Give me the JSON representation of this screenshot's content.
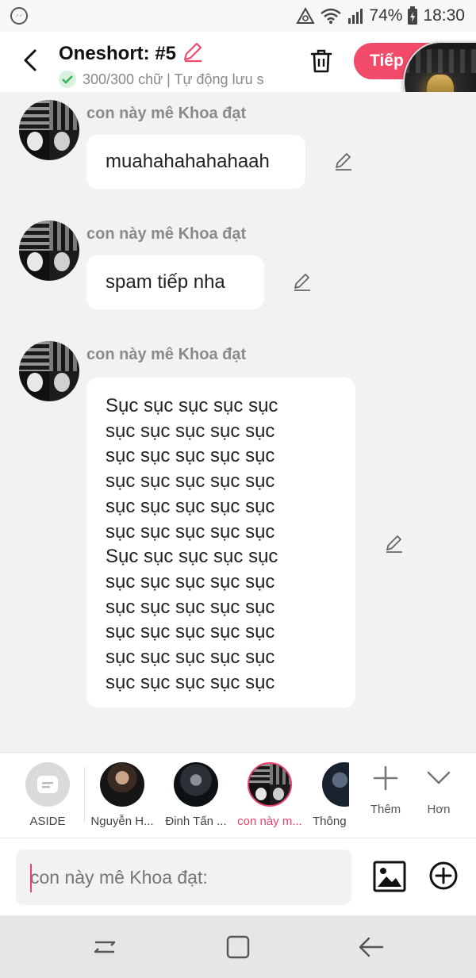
{
  "status_bar": {
    "battery": "74%",
    "time": "18:30",
    "icons": [
      "messenger-icon",
      "data-saver-icon",
      "wifi-icon",
      "signal-icon",
      "battery-icon"
    ]
  },
  "header": {
    "title": "Oneshort: #5",
    "subtitle": "300/300 chữ | Tự động lưu s",
    "next_label": "Tiếp",
    "accent_color": "#f24b6a"
  },
  "messages": [
    {
      "sender": "con này mê Khoa đạt",
      "text": "muahahahahahaah"
    },
    {
      "sender": "con này mê Khoa đạt",
      "text": "spam tiếp nha"
    },
    {
      "sender": "con này mê Khoa đạt",
      "text": "Sục sục sục sục sục\nsục sục sục sục sục\nsục sục sục sục sục\nsục sục sục sục sục\nsục sục sục sục sục\nsục sục sục sục sục\nSục sục sục sục sục\nsục sục sục sục sục\nsục sục sục sục sục\nsục sục sục sục sục\nsục sục sục sục sục\nsục sục sục sục sục"
    }
  ],
  "characters": [
    {
      "label": "ASIDE"
    },
    {
      "label": "Nguyễn H..."
    },
    {
      "label": "Đinh Tấn ..."
    },
    {
      "label": "con này m..."
    },
    {
      "label": "Thông"
    }
  ],
  "tools": {
    "more_label": "Thêm",
    "expand_label": "Hơn"
  },
  "input": {
    "placeholder": "con này mê Khoa đạt:"
  }
}
